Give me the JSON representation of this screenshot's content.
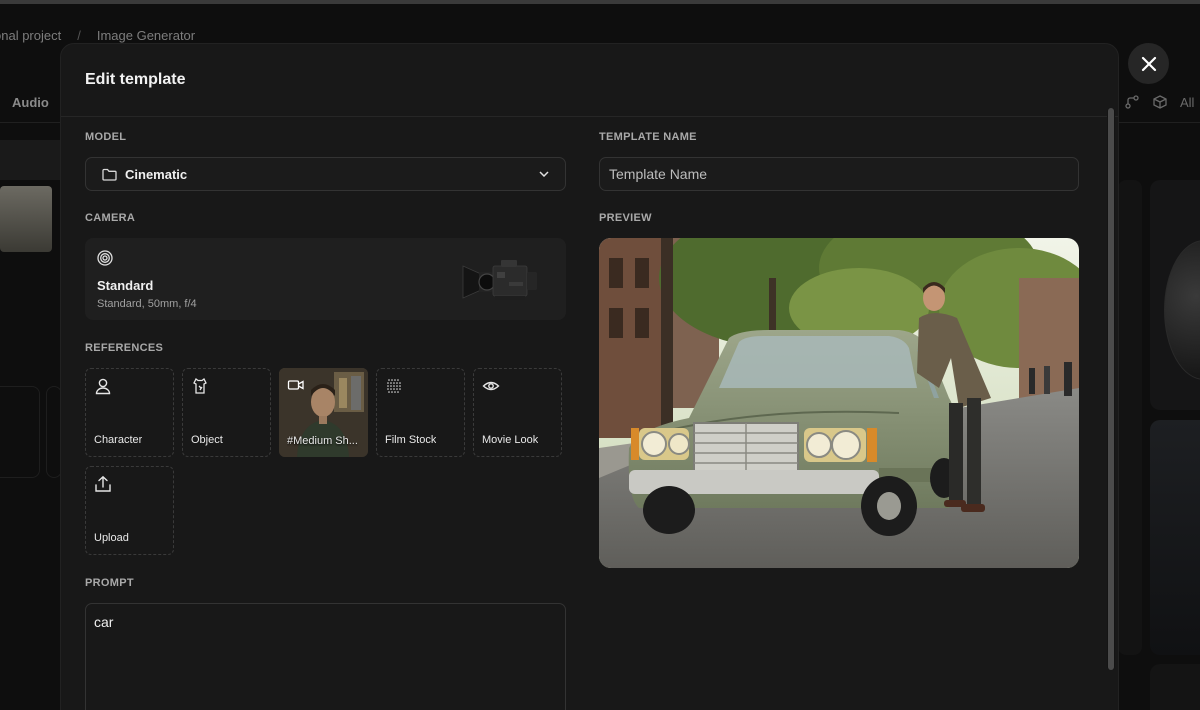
{
  "background": {
    "breadcrumb": {
      "project": "onal project",
      "separator": "/",
      "page": "Image Generator"
    },
    "nav_item": "Audio",
    "right_label": "All"
  },
  "modal": {
    "title": "Edit template",
    "close_icon": "close-icon",
    "model": {
      "label": "MODEL",
      "value": "Cinematic",
      "icon": "folder-icon",
      "chevron": "chevron-down-icon"
    },
    "camera": {
      "label": "CAMERA",
      "icon": "aperture-icon",
      "title": "Standard",
      "subtitle": "Standard, 50mm, f/4"
    },
    "references": {
      "label": "REFERENCES",
      "items": [
        {
          "label": "Character",
          "icon": "person-icon"
        },
        {
          "label": "Object",
          "icon": "object-icon"
        },
        {
          "label": "#Medium Sh...",
          "icon": "video-camera-icon"
        },
        {
          "label": "Film Stock",
          "icon": "film-grid-icon"
        },
        {
          "label": "Movie Look",
          "icon": "eye-icon"
        },
        {
          "label": "Upload",
          "icon": "upload-icon"
        }
      ]
    },
    "prompt": {
      "label": "PROMPT",
      "value": "car"
    },
    "template_name": {
      "label": "TEMPLATE NAME",
      "placeholder": "Template Name",
      "value": ""
    },
    "preview": {
      "label": "PREVIEW"
    }
  }
}
